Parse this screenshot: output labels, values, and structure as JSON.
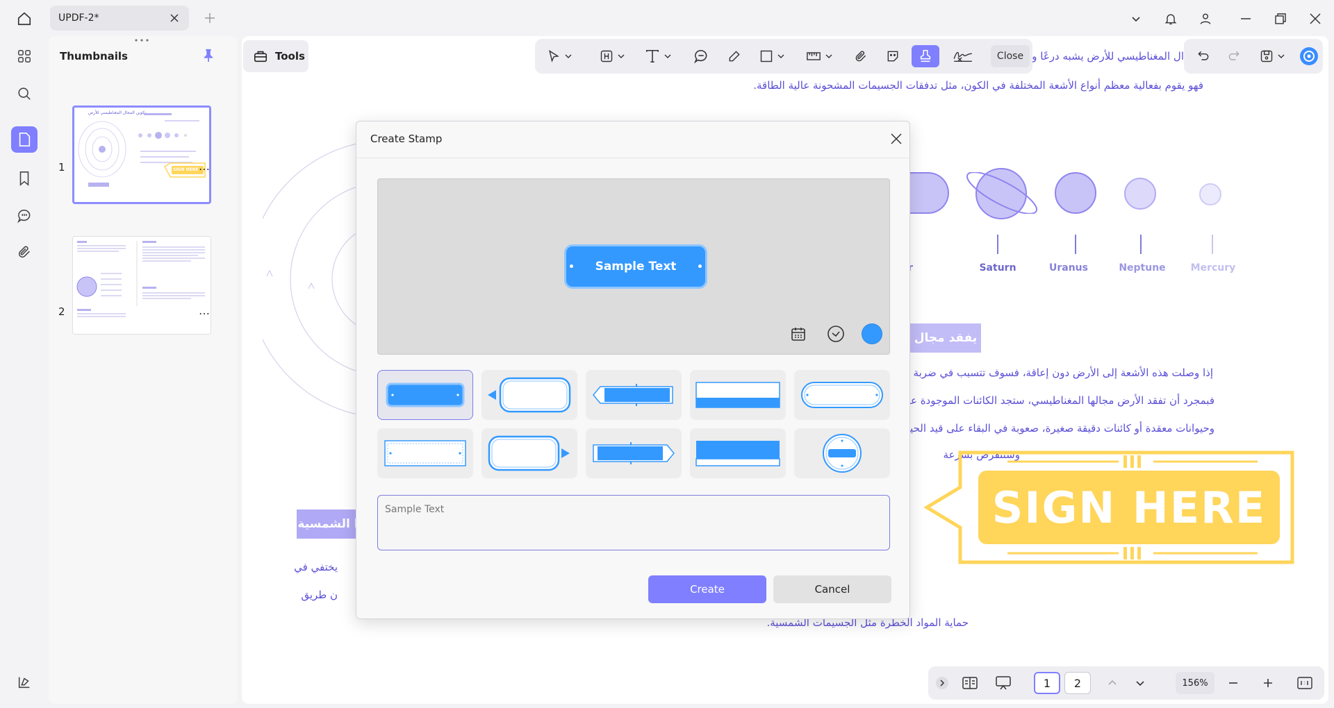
{
  "titlebar": {
    "tab_title": "UPDF-2*"
  },
  "thumbnails": {
    "title": "Thumbnails",
    "pages": [
      {
        "num": "1",
        "more": "…"
      },
      {
        "num": "2",
        "more": "…"
      }
    ],
    "thumb1_title": "تكوين المجال المغناطيسي للأرض",
    "thumb1_sign": "SIGN HERE"
  },
  "tools": {
    "label": "Tools"
  },
  "toolbar": {
    "close_label": "Close"
  },
  "document": {
    "lines": [
      "ال المغناطيسي للأرض يشبه درعًا وا",
      "فهو يقوم بفعالية معظم أنواع الأشعة المختلفة في الكون، مثل تدفقات الجسيمات المشحونة عالية الطاقة.",
      "إذا وصلت هذه الأشعة إلى الأرض دون إعاقة، فسوف تتسبب في ضربة مدمر",
      "فبمجرد أن تفقد الأرض مجالها المغناطيسي، ستجد الكائنات الموجودة على سطح",
      "وحيوانات معقدة أو كائنات دقيقة صغيرة، صعوبة في البقاء على قيد الحياة تح",
      "وستنقرض بسرعة",
      "حماية المواد الخطرة مثل الجسيمات الشمسية.",
      "يختفي في",
      "ن طريق"
    ],
    "bar_right": "يفقد مجال",
    "bar_left": "ا الشمسية",
    "planets": [
      "upiter",
      "Saturn",
      "Uranus",
      "Neptune",
      "Mercury"
    ],
    "sign_here": "SIGN HERE"
  },
  "dialog": {
    "title": "Create Stamp",
    "preview_text": "Sample Text",
    "input_placeholder": "Sample Text",
    "input_value": "",
    "create_label": "Create",
    "cancel_label": "Cancel",
    "stamp_color": "#3399ff"
  },
  "bottombar": {
    "page1": "1",
    "page2": "2",
    "zoom": "156%"
  },
  "colors": {
    "accent": "#7f7fff",
    "stamp_blue": "#3399ff",
    "sign_yellow": "#ffd55a"
  },
  "icons": [
    "home-icon",
    "close-icon",
    "plus-icon",
    "chevron-down-icon",
    "bell-icon",
    "user-icon",
    "minimize-icon",
    "restore-icon",
    "grid-icon",
    "search-icon",
    "page-icon",
    "bookmark-icon",
    "comment-icon",
    "attachment-icon",
    "layers-icon",
    "pin-icon",
    "toolbox-icon",
    "calendar-icon",
    "clock-icon"
  ]
}
